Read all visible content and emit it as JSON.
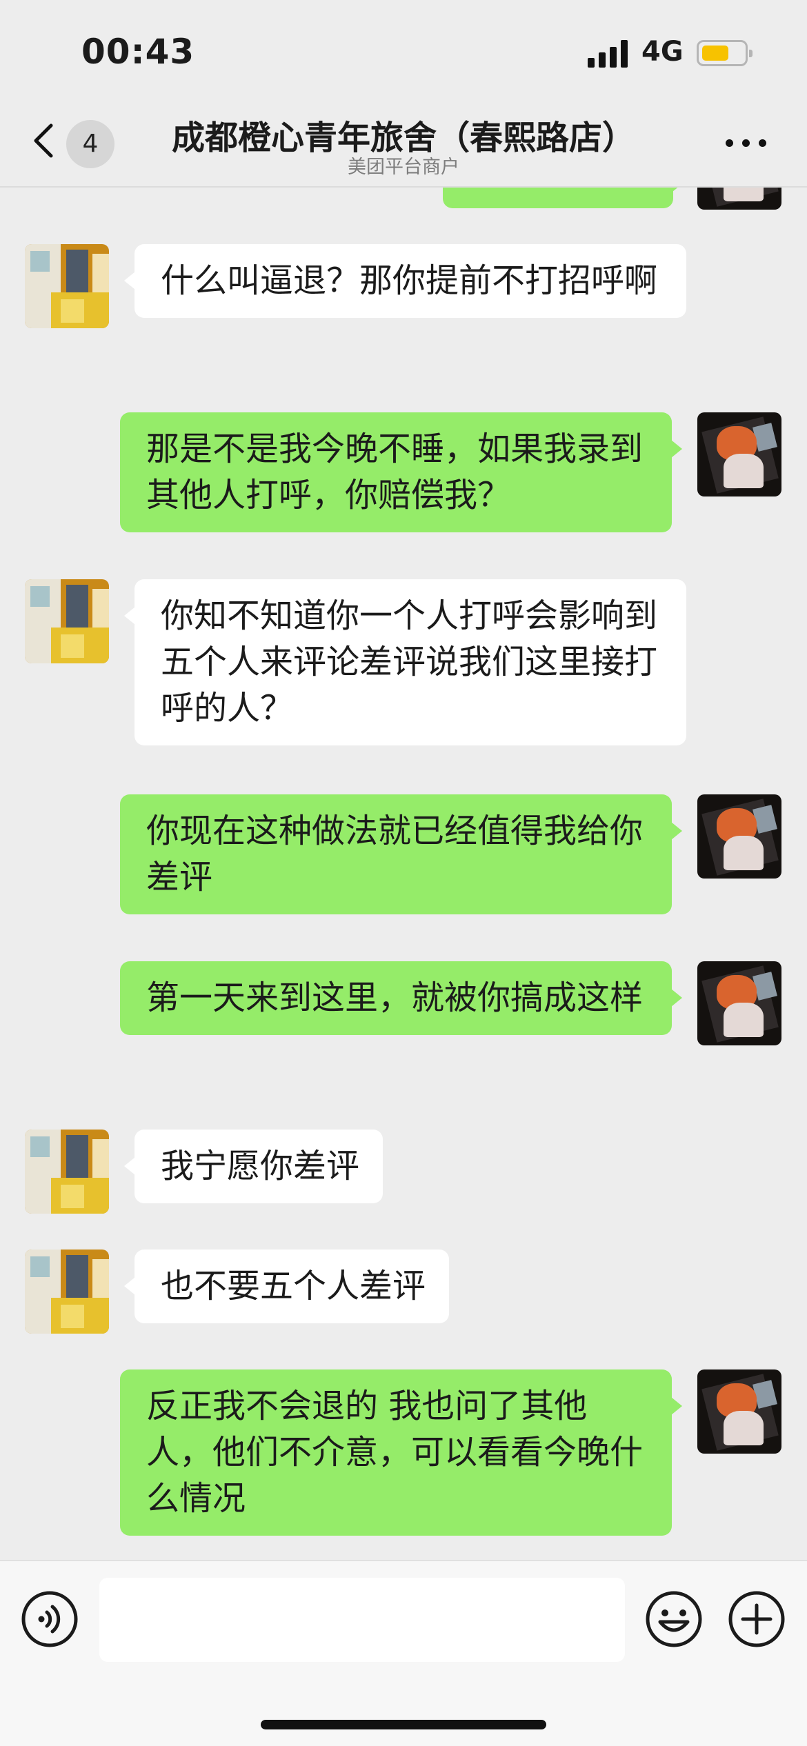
{
  "status": {
    "time": "00:43",
    "network": "4G",
    "battery_color": "#f7c200"
  },
  "nav": {
    "unread_count": "4",
    "title": "成都橙心青年旅舍（春熙路店）",
    "subtitle": "美团平台商户",
    "back_icon": "chevron-left-icon",
    "more_icon": "more-dots-icon"
  },
  "messages": [
    {
      "from": "user",
      "text": "",
      "partial": true
    },
    {
      "from": "hostel",
      "text": "什么叫逼退？那你提前不打招呼啊"
    },
    {
      "from": "user",
      "text": "那是不是我今晚不睡，如果我录到其他人打呼，你赔偿我？"
    },
    {
      "from": "hostel",
      "text": "你知不知道你一个人打呼会影响到五个人来评论差评说我们这里接打呼的人？"
    },
    {
      "from": "user",
      "text": "你现在这种做法就已经值得我给你差评"
    },
    {
      "from": "user",
      "text": "第一天来到这里，就被你搞成这样"
    },
    {
      "from": "hostel",
      "text": "我宁愿你差评"
    },
    {
      "from": "hostel",
      "text": "也不要五个人差评"
    },
    {
      "from": "user",
      "text": "反正我不会退的 我也问了其他人，他们不介意，可以看看今晚什么情况"
    }
  ],
  "colors": {
    "outgoing_bubble": "#95ec69",
    "incoming_bubble": "#ffffff",
    "background": "#ededed"
  },
  "input": {
    "value": "",
    "voice_icon": "voice-icon",
    "emoji_icon": "emoji-icon",
    "plus_icon": "plus-icon"
  }
}
